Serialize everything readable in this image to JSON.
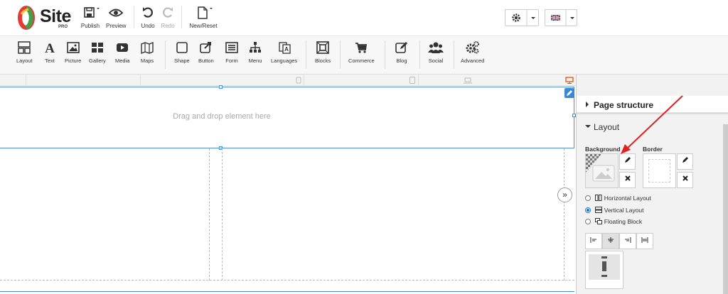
{
  "logo": {
    "text": "Site",
    "sub": "PRO"
  },
  "topbar": {
    "publish": "Publish",
    "preview": "Preview",
    "undo": "Undo",
    "redo": "Redo",
    "new_reset": "New/Reset"
  },
  "tools": {
    "layout": "Layout",
    "text": "Text",
    "picture": "Picture",
    "gallery": "Gallery",
    "media": "Media",
    "maps": "Maps",
    "shape": "Shape",
    "button": "Button",
    "form": "Form",
    "menu": "Menu",
    "languages": "Languages",
    "blocks": "Blocks",
    "commerce": "Commerce",
    "blog": "Blog",
    "social": "Social",
    "advanced": "Advanced"
  },
  "canvas": {
    "drop_text": "Drag and drop element here"
  },
  "panel": {
    "page_structure": "Page structure",
    "layout": "Layout",
    "background": "Background",
    "border": "Border",
    "horizontal_layout": "Horizontal Layout",
    "vertical_layout": "Vertical Layout",
    "floating_block": "Floating Block",
    "selected_layout": "Vertical Layout"
  },
  "colors": {
    "accent": "#3a86d8",
    "arrow": "#e02020",
    "logo_red": "#e53935",
    "logo_green": "#43a047"
  }
}
